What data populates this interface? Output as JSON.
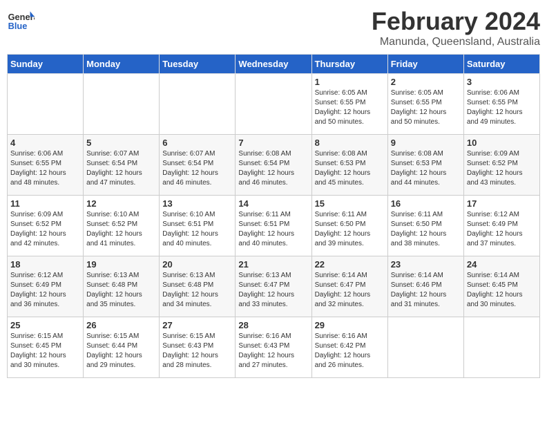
{
  "header": {
    "logo_general": "General",
    "logo_blue": "Blue",
    "month_year": "February 2024",
    "location": "Manunda, Queensland, Australia"
  },
  "days_of_week": [
    "Sunday",
    "Monday",
    "Tuesday",
    "Wednesday",
    "Thursday",
    "Friday",
    "Saturday"
  ],
  "weeks": [
    [
      {
        "day": "",
        "info": ""
      },
      {
        "day": "",
        "info": ""
      },
      {
        "day": "",
        "info": ""
      },
      {
        "day": "",
        "info": ""
      },
      {
        "day": "1",
        "info": "Sunrise: 6:05 AM\nSunset: 6:55 PM\nDaylight: 12 hours\nand 50 minutes."
      },
      {
        "day": "2",
        "info": "Sunrise: 6:05 AM\nSunset: 6:55 PM\nDaylight: 12 hours\nand 50 minutes."
      },
      {
        "day": "3",
        "info": "Sunrise: 6:06 AM\nSunset: 6:55 PM\nDaylight: 12 hours\nand 49 minutes."
      }
    ],
    [
      {
        "day": "4",
        "info": "Sunrise: 6:06 AM\nSunset: 6:55 PM\nDaylight: 12 hours\nand 48 minutes."
      },
      {
        "day": "5",
        "info": "Sunrise: 6:07 AM\nSunset: 6:54 PM\nDaylight: 12 hours\nand 47 minutes."
      },
      {
        "day": "6",
        "info": "Sunrise: 6:07 AM\nSunset: 6:54 PM\nDaylight: 12 hours\nand 46 minutes."
      },
      {
        "day": "7",
        "info": "Sunrise: 6:08 AM\nSunset: 6:54 PM\nDaylight: 12 hours\nand 46 minutes."
      },
      {
        "day": "8",
        "info": "Sunrise: 6:08 AM\nSunset: 6:53 PM\nDaylight: 12 hours\nand 45 minutes."
      },
      {
        "day": "9",
        "info": "Sunrise: 6:08 AM\nSunset: 6:53 PM\nDaylight: 12 hours\nand 44 minutes."
      },
      {
        "day": "10",
        "info": "Sunrise: 6:09 AM\nSunset: 6:52 PM\nDaylight: 12 hours\nand 43 minutes."
      }
    ],
    [
      {
        "day": "11",
        "info": "Sunrise: 6:09 AM\nSunset: 6:52 PM\nDaylight: 12 hours\nand 42 minutes."
      },
      {
        "day": "12",
        "info": "Sunrise: 6:10 AM\nSunset: 6:52 PM\nDaylight: 12 hours\nand 41 minutes."
      },
      {
        "day": "13",
        "info": "Sunrise: 6:10 AM\nSunset: 6:51 PM\nDaylight: 12 hours\nand 40 minutes."
      },
      {
        "day": "14",
        "info": "Sunrise: 6:11 AM\nSunset: 6:51 PM\nDaylight: 12 hours\nand 40 minutes."
      },
      {
        "day": "15",
        "info": "Sunrise: 6:11 AM\nSunset: 6:50 PM\nDaylight: 12 hours\nand 39 minutes."
      },
      {
        "day": "16",
        "info": "Sunrise: 6:11 AM\nSunset: 6:50 PM\nDaylight: 12 hours\nand 38 minutes."
      },
      {
        "day": "17",
        "info": "Sunrise: 6:12 AM\nSunset: 6:49 PM\nDaylight: 12 hours\nand 37 minutes."
      }
    ],
    [
      {
        "day": "18",
        "info": "Sunrise: 6:12 AM\nSunset: 6:49 PM\nDaylight: 12 hours\nand 36 minutes."
      },
      {
        "day": "19",
        "info": "Sunrise: 6:13 AM\nSunset: 6:48 PM\nDaylight: 12 hours\nand 35 minutes."
      },
      {
        "day": "20",
        "info": "Sunrise: 6:13 AM\nSunset: 6:48 PM\nDaylight: 12 hours\nand 34 minutes."
      },
      {
        "day": "21",
        "info": "Sunrise: 6:13 AM\nSunset: 6:47 PM\nDaylight: 12 hours\nand 33 minutes."
      },
      {
        "day": "22",
        "info": "Sunrise: 6:14 AM\nSunset: 6:47 PM\nDaylight: 12 hours\nand 32 minutes."
      },
      {
        "day": "23",
        "info": "Sunrise: 6:14 AM\nSunset: 6:46 PM\nDaylight: 12 hours\nand 31 minutes."
      },
      {
        "day": "24",
        "info": "Sunrise: 6:14 AM\nSunset: 6:45 PM\nDaylight: 12 hours\nand 30 minutes."
      }
    ],
    [
      {
        "day": "25",
        "info": "Sunrise: 6:15 AM\nSunset: 6:45 PM\nDaylight: 12 hours\nand 30 minutes."
      },
      {
        "day": "26",
        "info": "Sunrise: 6:15 AM\nSunset: 6:44 PM\nDaylight: 12 hours\nand 29 minutes."
      },
      {
        "day": "27",
        "info": "Sunrise: 6:15 AM\nSunset: 6:43 PM\nDaylight: 12 hours\nand 28 minutes."
      },
      {
        "day": "28",
        "info": "Sunrise: 6:16 AM\nSunset: 6:43 PM\nDaylight: 12 hours\nand 27 minutes."
      },
      {
        "day": "29",
        "info": "Sunrise: 6:16 AM\nSunset: 6:42 PM\nDaylight: 12 hours\nand 26 minutes."
      },
      {
        "day": "",
        "info": ""
      },
      {
        "day": "",
        "info": ""
      }
    ]
  ]
}
